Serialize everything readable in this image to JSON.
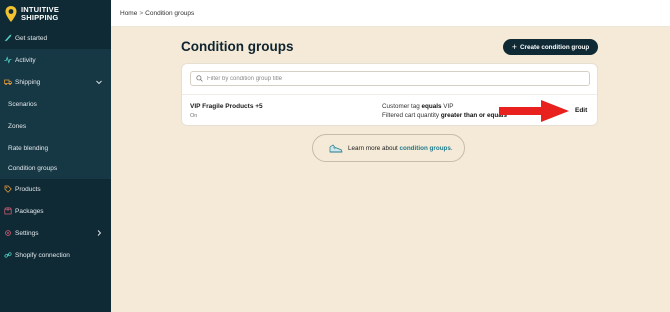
{
  "brand": {
    "line1": "INTUITIVE",
    "line2": "SHIPPING"
  },
  "sidebar": {
    "items": [
      {
        "label": "Get started",
        "icon": "rocket-icon"
      },
      {
        "label": "Activity",
        "icon": "activity-icon"
      },
      {
        "label": "Shipping",
        "icon": "truck-icon"
      },
      {
        "label": "Scenarios"
      },
      {
        "label": "Zones"
      },
      {
        "label": "Rate blending"
      },
      {
        "label": "Condition groups"
      },
      {
        "label": "Products",
        "icon": "tag-icon"
      },
      {
        "label": "Packages",
        "icon": "package-icon"
      },
      {
        "label": "Settings",
        "icon": "gear-icon"
      },
      {
        "label": "Shopify connection",
        "icon": "link-icon"
      }
    ]
  },
  "breadcrumb": {
    "home": "Home",
    "separator": ">",
    "current": "Condition groups"
  },
  "page": {
    "title": "Condition groups",
    "create_button": "Create condition group"
  },
  "search": {
    "placeholder": "Filter by condition group title"
  },
  "groups": [
    {
      "name": "VIP Fragile Products +5",
      "status": "On",
      "conditions": [
        {
          "prefix": "Customer tag",
          "op": "equals",
          "value": "VIP"
        },
        {
          "prefix": "Filtered cart quantity",
          "op": "greater than or equals",
          "value": ""
        }
      ],
      "action": "Edit"
    }
  ],
  "learn_more": {
    "text": "Learn more about",
    "link": "condition groups",
    "suffix": "."
  },
  "colors": {
    "sidebar": "#0f2a35",
    "background": "#f4ead7",
    "accent": "#1f7a8c",
    "arrow": "#e8201e"
  }
}
